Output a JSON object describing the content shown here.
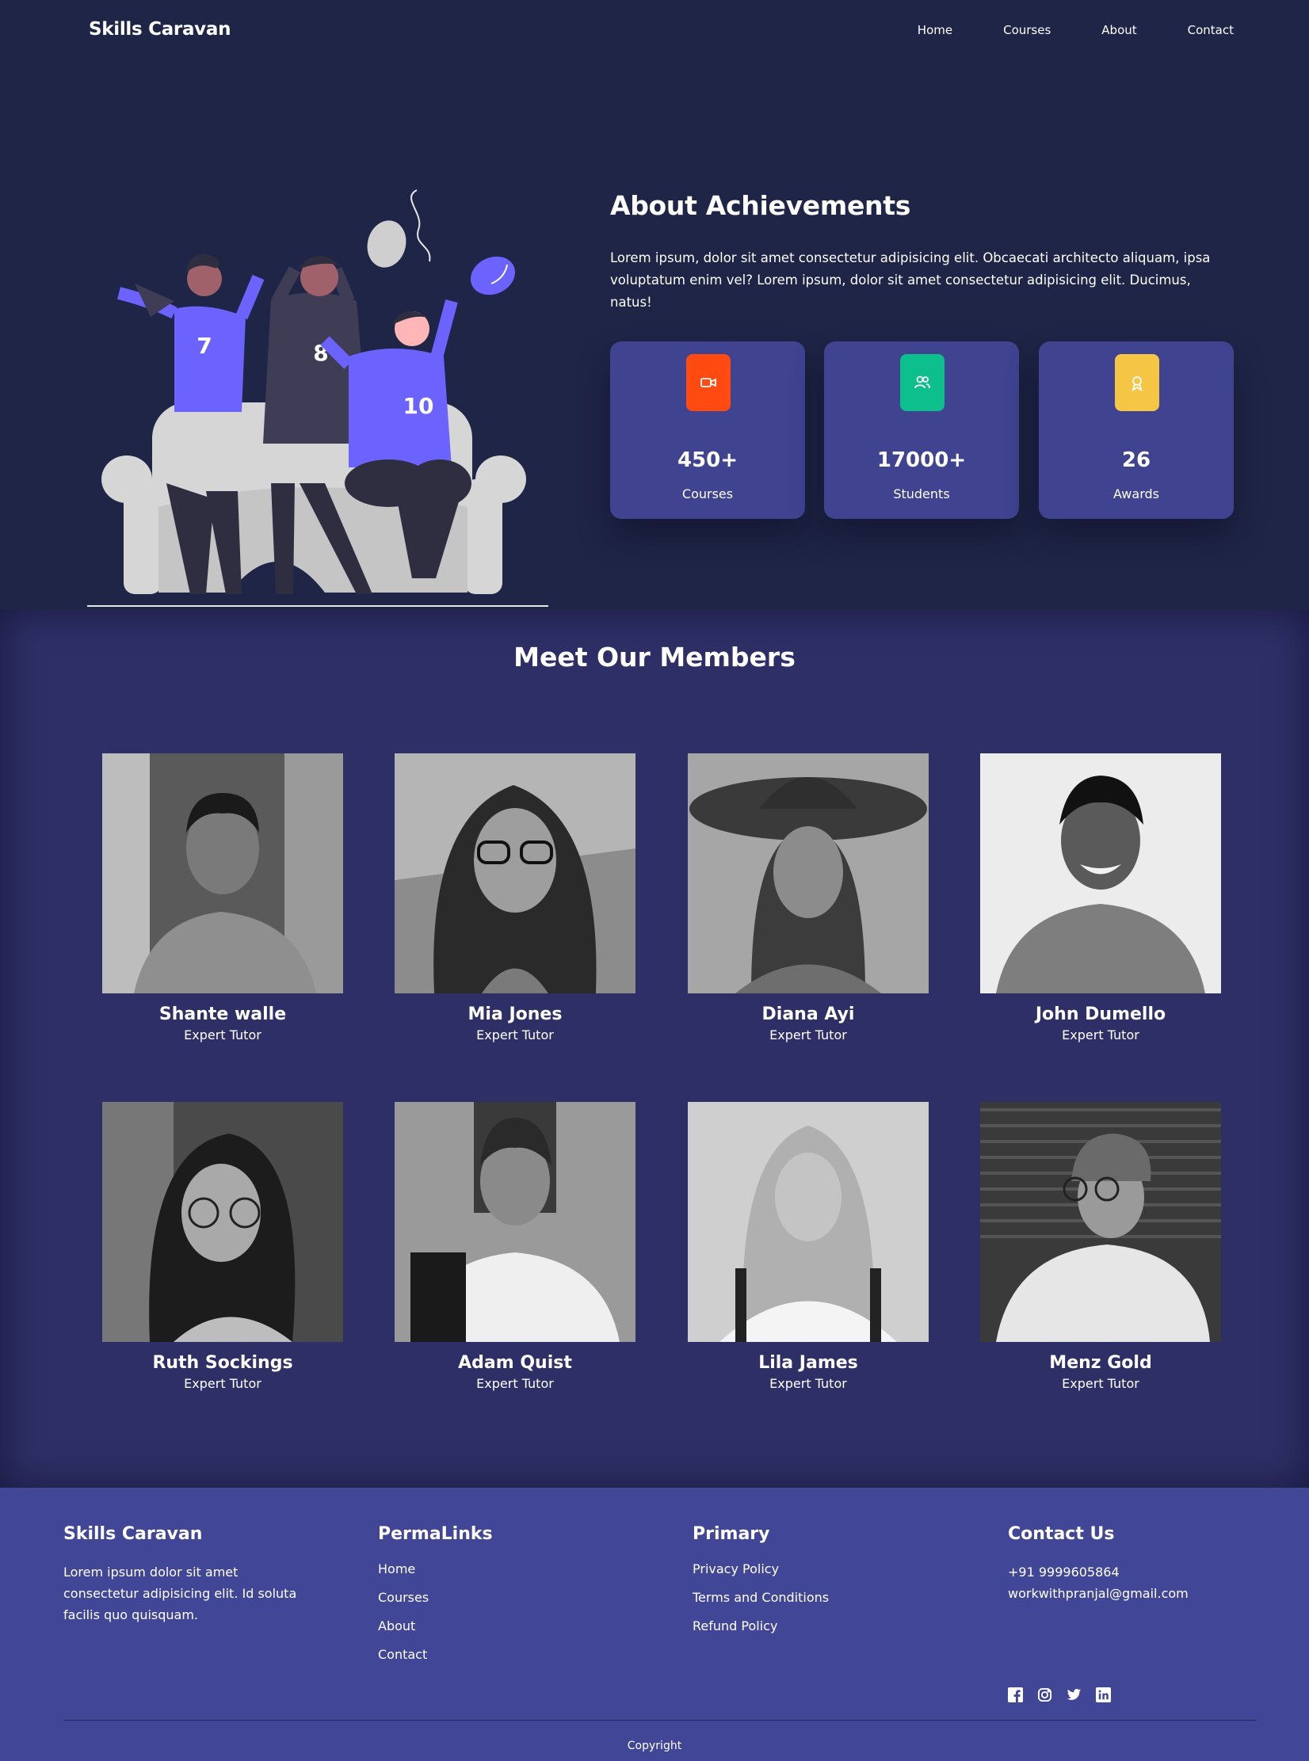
{
  "header": {
    "logo": "Skills Caravan",
    "nav": [
      "Home",
      "Courses",
      "About",
      "Contact"
    ]
  },
  "hero": {
    "title": "About Achievements",
    "text": "Lorem ipsum, dolor sit amet consectetur adipisicing elit. Obcaecati architecto aliquam, ipsa voluptatum enim vel? Lorem ipsum, dolor sit amet consectetur adipisicing elit. Ducimus, natus!",
    "jersey_numbers": [
      "7",
      "8",
      "10"
    ],
    "stats": [
      {
        "value": "450+",
        "label": "Courses",
        "icon": "video-camera-icon",
        "color": "#ff4a12"
      },
      {
        "value": "17000+",
        "label": "Students",
        "icon": "users-icon",
        "color": "#0cbf8c"
      },
      {
        "value": "26",
        "label": "Awards",
        "icon": "award-icon",
        "color": "#f5c544"
      }
    ]
  },
  "members": {
    "title": "Meet Our Members",
    "list": [
      {
        "name": "Shante walle",
        "role": "Expert Tutor"
      },
      {
        "name": "Mia Jones",
        "role": "Expert Tutor"
      },
      {
        "name": "Diana Ayi",
        "role": "Expert Tutor"
      },
      {
        "name": "John Dumello",
        "role": "Expert Tutor"
      },
      {
        "name": "Ruth Sockings",
        "role": "Expert Tutor"
      },
      {
        "name": "Adam Quist",
        "role": "Expert Tutor"
      },
      {
        "name": "Lila James",
        "role": "Expert Tutor"
      },
      {
        "name": "Menz Gold",
        "role": "Expert Tutor"
      }
    ]
  },
  "footer": {
    "brand": {
      "title": "Skills Caravan",
      "text": "Lorem ipsum dolor sit amet consectetur adipisicing elit. Id soluta facilis quo quisquam."
    },
    "permalinks": {
      "title": "PermaLinks",
      "links": [
        "Home",
        "Courses",
        "About",
        "Contact"
      ]
    },
    "primary": {
      "title": "Primary",
      "links": [
        "Privacy Policy",
        "Terms and Conditions",
        "Refund Policy"
      ]
    },
    "contact": {
      "title": "Contact Us",
      "phone": "+91 9999605864",
      "email": "workwithpranjal@gmail.com"
    },
    "social": [
      "facebook-icon",
      "instagram-icon",
      "twitter-icon",
      "linkedin-icon"
    ],
    "copyright": "Copyright"
  },
  "colors": {
    "page_bg": "#1f2547",
    "card_bg": "#3f4390",
    "members_bg": "#2e2f66",
    "footer_bg": "#414696",
    "accent_purple": "#6c63ff"
  }
}
